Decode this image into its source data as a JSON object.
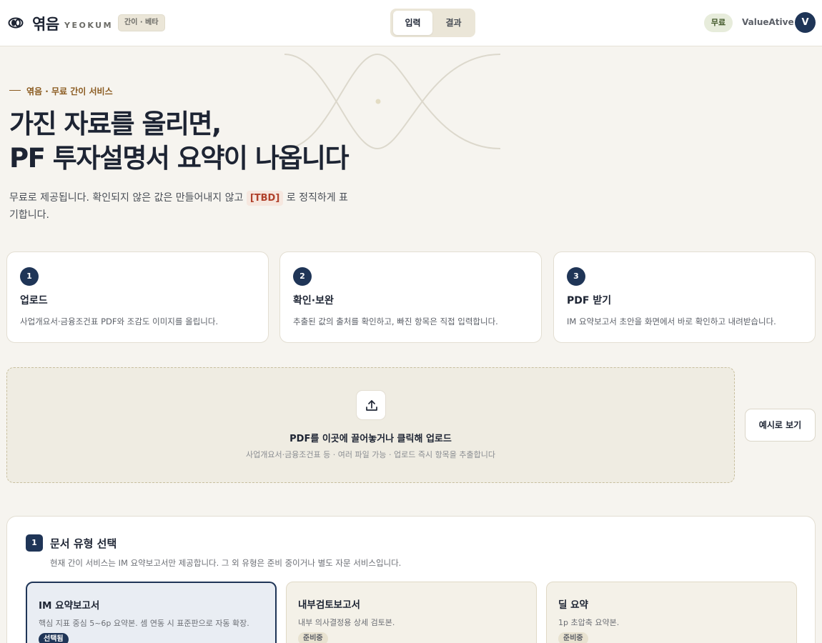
{
  "header": {
    "brand_ko": "엮음",
    "brand_en": "YEOKUM",
    "beta_badge": "간이 · 베타",
    "tabs": [
      {
        "label": "입력",
        "active": true
      },
      {
        "label": "결과",
        "active": false
      }
    ],
    "plan_badge": "무료",
    "user_name": "ValueAtive",
    "avatar_initial": "V"
  },
  "hero": {
    "eyebrow": "엮음 · 무료 간이 서비스",
    "headline_line1": "가진 자료를 올리면,",
    "headline_line2": "PF 투자설명서 요약이 나옵니다",
    "subcopy_before": "무료로 제공됩니다. 확인되지 않은 값은 만들어내지 않고 ",
    "subcopy_tag": "[TBD]",
    "subcopy_after": " 로 정직하게 표기합니다."
  },
  "steps": [
    {
      "num": "1",
      "title": "업로드",
      "desc": "사업개요서·금융조건표 PDF와 조감도 이미지를 올립니다."
    },
    {
      "num": "2",
      "title": "확인·보완",
      "desc": "추출된 값의 출처를 확인하고, 빠진 항목은 직접 입력합니다."
    },
    {
      "num": "3",
      "title": "PDF 받기",
      "desc": "IM 요약보고서 초안을 화면에서 바로 확인하고 내려받습니다."
    }
  ],
  "dropzone": {
    "title": "PDF를 이곳에 끌어놓거나 클릭해 업로드",
    "subtitle": "사업개요서·금융조건표 등 · 여러 파일 가능 · 업로드 즉시 항목을 추출합니다"
  },
  "example_button": "예시로 보기",
  "doc_type": {
    "num": "1",
    "title": "문서 유형 선택",
    "subtitle": "현재 간이 서비스는 IM 요약보고서만 제공합니다. 그 외 유형은 준비 중이거나 별도 자문 서비스입니다.",
    "cards": [
      {
        "name": "IM 요약보고서",
        "desc": "핵심 지표 중심 5~6p 요약본. 셈 연동 시 표준판으로 자동 확장.",
        "badge": "선택됨"
      },
      {
        "name": "내부검토보고서",
        "desc": "내부 의사결정용 상세 검토본.",
        "badge": "준비중"
      },
      {
        "name": "딜 요약",
        "desc": "1p 초압축 요약본.",
        "badge": "준비중"
      }
    ]
  },
  "colors": {
    "navy": "#1f3557",
    "accent_brown": "#8a5a1f",
    "tbd_red": "#b0412b",
    "background": "#f6f4ef"
  },
  "icons": [
    "logo-mark-icon",
    "upload-icon"
  ]
}
